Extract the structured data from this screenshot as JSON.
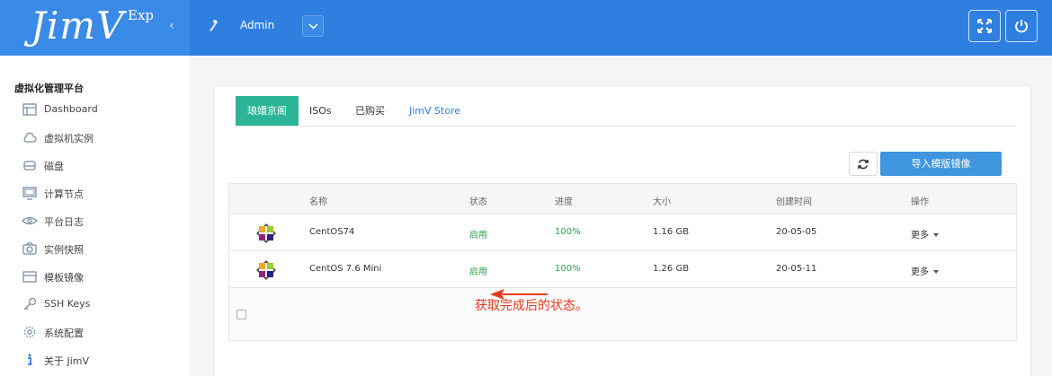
{
  "header": {
    "brand": "JimV",
    "brand_suffix": "Exp",
    "collapse_glyph": "‹",
    "user_name": "Admin",
    "icons": [
      "user-icon",
      "chevron-down-icon",
      "fullscreen-icon",
      "power-icon"
    ]
  },
  "sidebar": {
    "title": "虚拟化管理平台",
    "items": [
      {
        "label": "Dashboard",
        "icon": "dashboard-icon"
      },
      {
        "label": "虚拟机实例",
        "icon": "cloud-icon"
      },
      {
        "label": "磁盘",
        "icon": "disk-icon"
      },
      {
        "label": "计算节点",
        "icon": "monitor-icon"
      },
      {
        "label": "平台日志",
        "icon": "eye-icon"
      },
      {
        "label": "实例快照",
        "icon": "camera-icon"
      },
      {
        "label": "模板镜像",
        "icon": "template-icon"
      },
      {
        "label": "SSH Keys",
        "icon": "key-icon"
      },
      {
        "label": "系统配置",
        "icon": "gear-icon"
      },
      {
        "label": "关于 JimV",
        "icon": "info-icon"
      }
    ]
  },
  "tabs": [
    {
      "label": "琅嬛京阁"
    },
    {
      "label": "ISOs"
    },
    {
      "label": "已购买"
    },
    {
      "label": "JimV Store"
    }
  ],
  "toolbar": {
    "refresh_icon": "refresh-icon",
    "import_label": "导入模版镜像"
  },
  "table": {
    "headers": [
      "名称",
      "状态",
      "进度",
      "大小",
      "创建时间",
      "操作"
    ],
    "rows": [
      {
        "name": "CentOS74",
        "status": "启用",
        "progress": "100%",
        "size": "1.16 GB",
        "created": "20-05-05",
        "action": "更多"
      },
      {
        "name": "CentOS 7.6 Mini",
        "status": "启用",
        "progress": "100%",
        "size": "1.26 GB",
        "created": "20-05-11",
        "action": "更多"
      }
    ]
  },
  "annotation": {
    "text": "获取完成后的状态。",
    "color": "#e8391d"
  },
  "colors": {
    "header": "#2f7fe0",
    "active_tab": "#2bb596",
    "import_button": "#3f95de",
    "status_green": "#2aa34a"
  }
}
